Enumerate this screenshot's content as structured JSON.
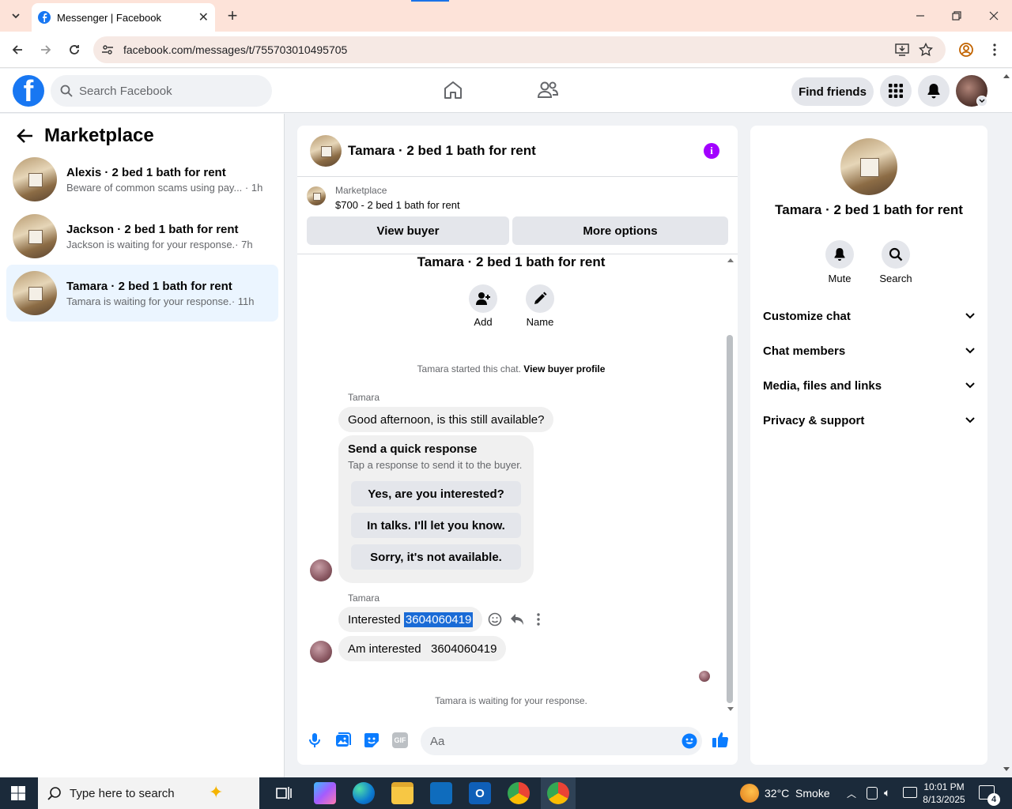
{
  "browser": {
    "tab_title": "Messenger | Facebook",
    "url": "facebook.com/messages/t/755703010495705"
  },
  "fb_header": {
    "search_placeholder": "Search Facebook",
    "find_friends": "Find friends"
  },
  "sidebar": {
    "title": "Marketplace",
    "conversations": [
      {
        "name": "Alexis · 2 bed 1 bath for rent",
        "preview": "Beware of common scams using pay...",
        "time": "· 1h"
      },
      {
        "name": "Jackson · 2 bed 1 bath for rent",
        "preview": "Jackson is waiting for your response.",
        "time": "· 7h"
      },
      {
        "name": "Tamara · 2 bed 1 bath for rent",
        "preview": "Tamara is waiting for your response.",
        "time": "· 11h"
      }
    ]
  },
  "chat": {
    "title": "Tamara · 2 bed 1 bath for rent",
    "listing_source": "Marketplace",
    "listing": "$700 - 2 bed 1 bath for rent",
    "view_buyer": "View buyer",
    "more_options": "More options",
    "group_title": "Tamara · 2 bed 1 bath for rent",
    "add_label": "Add",
    "name_label": "Name",
    "started_text": "Tamara started this chat.",
    "view_buyer_profile": "View buyer profile",
    "sender": "Tamara",
    "msg1": "Good afternoon, is this still available?",
    "quick_title": "Send a quick response",
    "quick_sub": "Tap a response to send it to the buyer.",
    "quick_responses": [
      "Yes, are you interested?",
      "In talks. I'll let you know.",
      "Sorry, it's not available."
    ],
    "msg2_prefix": "Interested ",
    "msg2_selected": "3604060419",
    "msg3": "Am interested   3604060419",
    "waiting": "Tamara is waiting for your response.",
    "input_placeholder": "Aa"
  },
  "info_panel": {
    "title": "Tamara · 2 bed 1 bath for rent",
    "mute": "Mute",
    "search": "Search",
    "sections": [
      "Customize chat",
      "Chat members",
      "Media, files and links",
      "Privacy & support"
    ]
  },
  "taskbar": {
    "search_placeholder": "Type here to search",
    "weather": "32°C  Smoke",
    "time": "10:01 PM",
    "date": "8/13/2025",
    "notif_count": "4"
  },
  "colors": {
    "accent": "#0a7cff",
    "fb_blue": "#1877f2",
    "info_purple": "#a200ff",
    "active_row": "#ebf5ff"
  }
}
